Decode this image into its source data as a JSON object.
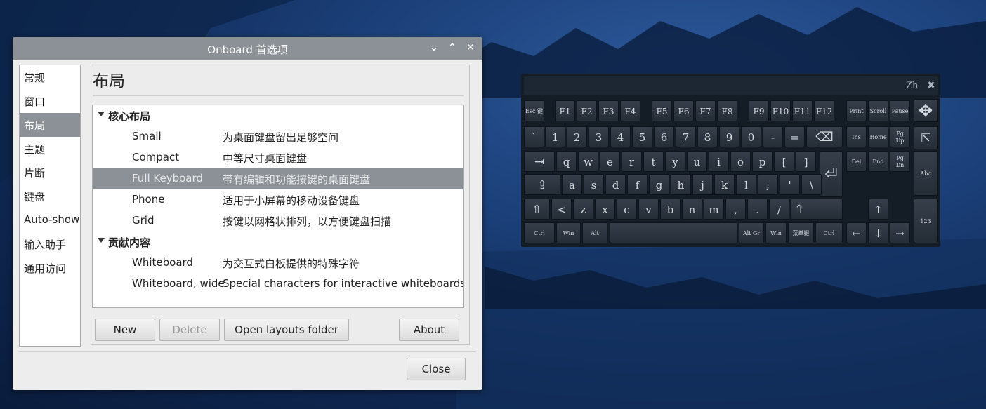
{
  "window": {
    "title": "Onboard 首选项",
    "controls": {
      "minimize": "⌄",
      "maximize": "⌃",
      "close": "✕"
    }
  },
  "sidebar": {
    "items": [
      {
        "label": "常规"
      },
      {
        "label": "窗口"
      },
      {
        "label": "布局",
        "selected": true
      },
      {
        "label": "主题"
      },
      {
        "label": "片断"
      },
      {
        "label": "键盘"
      },
      {
        "label": "Auto-show"
      },
      {
        "label": "输入助手"
      },
      {
        "label": "通用访问"
      }
    ]
  },
  "content": {
    "title": "布局",
    "groups": [
      {
        "label": "核心布局",
        "rows": [
          {
            "name": "Small",
            "desc": "为桌面键盘留出足够空间"
          },
          {
            "name": "Compact",
            "desc": "中等尺寸桌面键盘"
          },
          {
            "name": "Full Keyboard",
            "desc": "带有编辑和功能按键的桌面键盘",
            "selected": true
          },
          {
            "name": "Phone",
            "desc": "适用于小屏幕的移动设备键盘"
          },
          {
            "name": "Grid",
            "desc": "按键以网格状排列，以方便键盘扫描"
          }
        ]
      },
      {
        "label": "贡献内容",
        "rows": [
          {
            "name": "Whiteboard",
            "desc": "为交互式白板提供的特殊字符"
          },
          {
            "name": "Whiteboard, wide",
            "desc": "Special characters for interactive whiteboards, wi"
          }
        ]
      }
    ],
    "buttons": {
      "new": "New",
      "delete": "Delete",
      "open_folder": "Open layouts folder",
      "about": "About"
    }
  },
  "footer": {
    "close": "Close"
  },
  "keyboard": {
    "top_bar": {
      "lang": "Zh",
      "close": "✖"
    },
    "rows": {
      "fn": [
        "Esc 键",
        "F1",
        "F2",
        "F3",
        "F4",
        "F5",
        "F6",
        "F7",
        "F8",
        "F9",
        "F10",
        "F11",
        "F12"
      ],
      "nav_top": [
        "Print",
        "Scroll",
        "Pause",
        "✥"
      ],
      "num": [
        "`",
        "1",
        "2",
        "3",
        "4",
        "5",
        "6",
        "7",
        "8",
        "9",
        "0",
        "-",
        "=",
        "⌫"
      ],
      "nav1": [
        "Ins",
        "Home",
        "Pg Up",
        "⇱"
      ],
      "q": [
        "⇥",
        "q",
        "w",
        "e",
        "r",
        "t",
        "y",
        "u",
        "i",
        "o",
        "p",
        "[",
        "]",
        "⏎"
      ],
      "nav2": [
        "Del",
        "End",
        "Pg Dn",
        "Abc"
      ],
      "a": [
        "⇪",
        "a",
        "s",
        "d",
        "f",
        "g",
        "h",
        "j",
        "k",
        "l",
        ";",
        "'",
        "\\"
      ],
      "z": [
        "⇧",
        "<",
        "z",
        "x",
        "c",
        "v",
        "b",
        "n",
        "m",
        ",",
        ".",
        "/",
        "⇧"
      ],
      "arrows": [
        "↑",
        "←",
        "↓",
        "→",
        "123"
      ],
      "bottom": [
        "Ctrl",
        "Win",
        "Alt",
        "",
        "Alt Gr",
        "Win",
        "菜单键",
        "Ctrl"
      ]
    }
  },
  "colors": {
    "titlebar": "#8b9196",
    "selection": "#8b9196",
    "keyboard_bg": "#141c26",
    "key_text": "#d4d9de"
  }
}
